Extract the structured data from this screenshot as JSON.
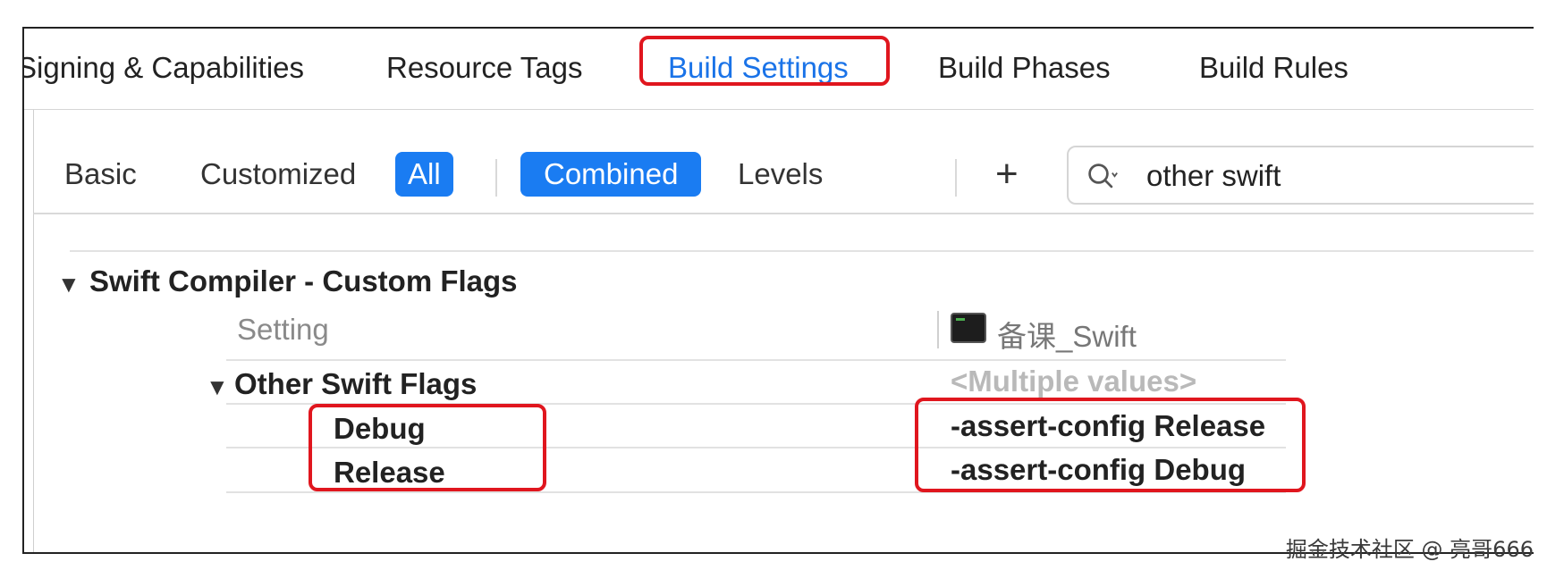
{
  "tabs": [
    {
      "label": "Signing & Capabilities"
    },
    {
      "label": "Resource Tags"
    },
    {
      "label": "Build Settings"
    },
    {
      "label": "Build Phases"
    },
    {
      "label": "Build Rules"
    }
  ],
  "filters": {
    "basic": "Basic",
    "customized": "Customized",
    "all": "All",
    "combined": "Combined",
    "levels": "Levels",
    "add": "+"
  },
  "search": {
    "value": "other swift"
  },
  "section": {
    "title": "Swift Compiler - Custom Flags",
    "setting_header": "Setting",
    "target_name": "备课_Swift",
    "group": {
      "title": "Other Swift Flags",
      "value": "<Multiple values>",
      "rows": [
        {
          "label": "Debug",
          "value": "-assert-config Release"
        },
        {
          "label": "Release",
          "value": "-assert-config Debug"
        }
      ]
    }
  },
  "watermark": "掘金技术社区 @ 亮哥666",
  "colors": {
    "accent": "#1a7cf2",
    "highlight": "#e0161e"
  },
  "icons": [
    "search-icon",
    "disclosure-triangle-icon",
    "terminal-target-icon"
  ]
}
